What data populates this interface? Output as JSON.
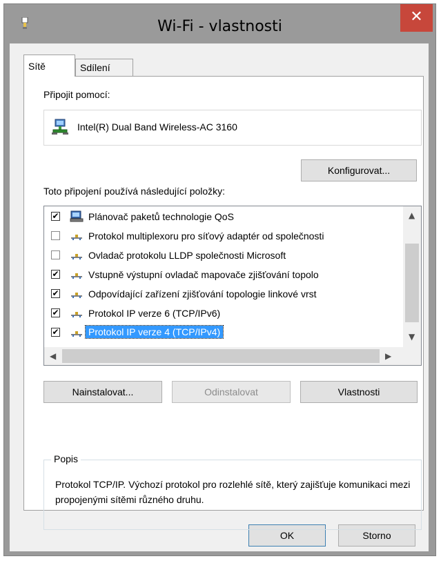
{
  "window": {
    "title": "Wi-Fi - vlastnosti",
    "close_glyph": "✕"
  },
  "tabs": [
    {
      "label": "Sítě",
      "active": true
    },
    {
      "label": "Sdílení",
      "active": false
    }
  ],
  "connect": {
    "label": "Připojit pomocí:",
    "adapter_icon": "network-adapter-icon",
    "adapter_name": "Intel(R) Dual Band Wireless-AC 3160",
    "configure_label": "Konfigurovat..."
  },
  "items": {
    "label": "Toto připojení používá následující položky:",
    "rows": [
      {
        "checked": true,
        "icon": "qos-icon",
        "text": "Plánovač paketů technologie QoS",
        "selected": false
      },
      {
        "checked": false,
        "icon": "protocol-icon",
        "text": "Protokol multiplexoru pro síťový adaptér od společnosti",
        "selected": false
      },
      {
        "checked": false,
        "icon": "protocol-icon",
        "text": "Ovladač protokolu LLDP společnosti Microsoft",
        "selected": false
      },
      {
        "checked": true,
        "icon": "protocol-icon",
        "text": "Vstupně výstupní ovladač mapovače zjišťování topolo",
        "selected": false
      },
      {
        "checked": true,
        "icon": "protocol-icon",
        "text": "Odpovídající zařízení zjišťování topologie linkové vrst",
        "selected": false
      },
      {
        "checked": true,
        "icon": "protocol-icon",
        "text": "Protokol IP verze 6 (TCP/IPv6)",
        "selected": false
      },
      {
        "checked": true,
        "icon": "protocol-icon",
        "text": "Protokol IP verze 4 (TCP/IPv4)",
        "selected": true
      }
    ],
    "check_glyph": "✔"
  },
  "actions": {
    "install": "Nainstalovat...",
    "uninstall": "Odinstalovat",
    "properties": "Vlastnosti"
  },
  "description": {
    "title": "Popis",
    "text": "Protokol TCP/IP. Výchozí protokol pro rozlehlé sítě, který zajišťuje komunikaci mezi propojenými sítěmi různého druhu."
  },
  "footer": {
    "ok": "OK",
    "cancel": "Storno"
  },
  "colors": {
    "selection": "#3399ff",
    "close": "#c7473b",
    "frame": "#9a9a9a"
  }
}
